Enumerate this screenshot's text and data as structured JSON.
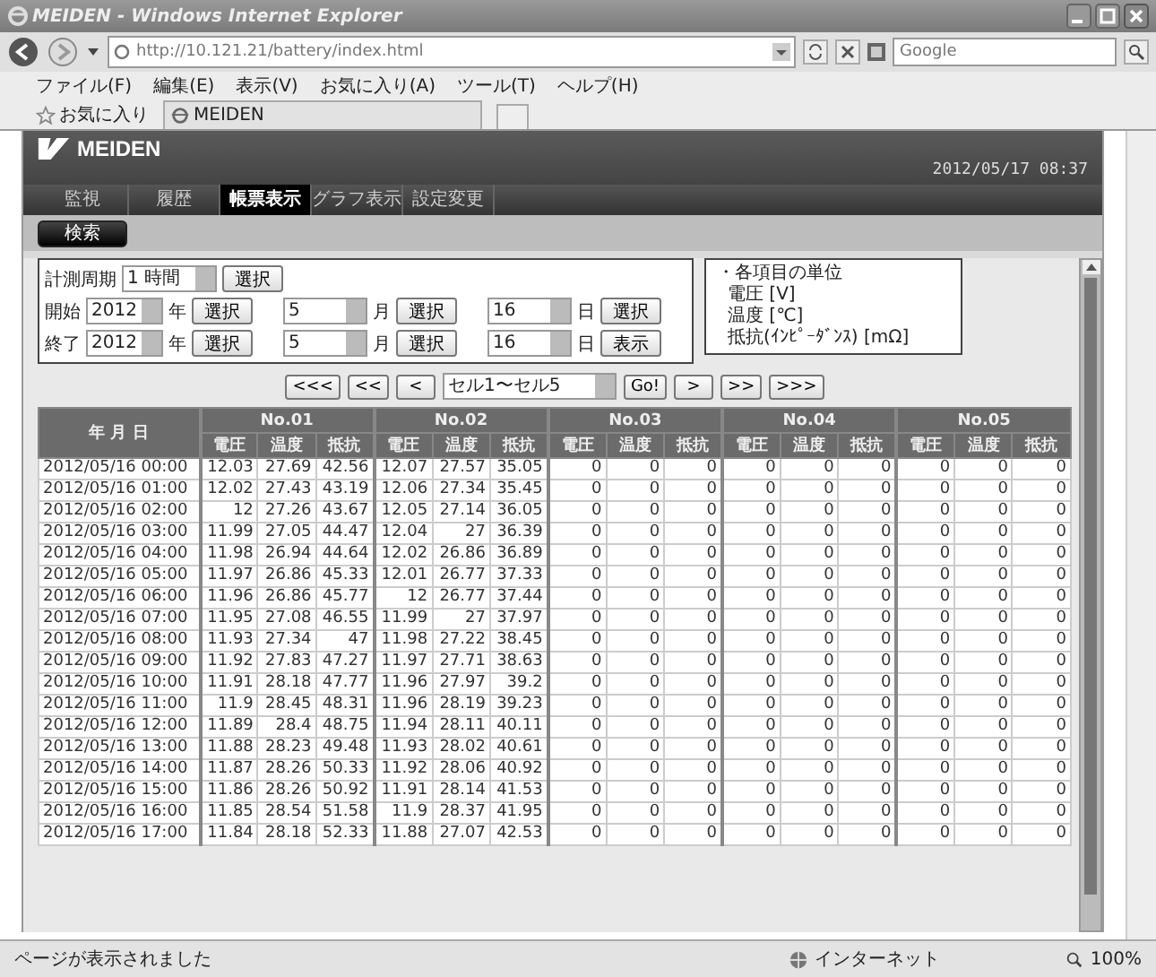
{
  "window": {
    "title": "MEIDEN - Windows Internet Explorer"
  },
  "address_bar": {
    "url": "http://10.121.21/battery/index.html",
    "search_placeholder": "Google"
  },
  "menu": [
    "ファイル(F)",
    "編集(E)",
    "表示(V)",
    "お気に入り(A)",
    "ツール(T)",
    "ヘルプ(H)"
  ],
  "favorites_bar": {
    "label": "お気に入り",
    "tab": "MEIDEN"
  },
  "page": {
    "logo": "MEIDEN",
    "datetime": "2012/05/17 08:37",
    "nav": [
      {
        "label": "監視",
        "selected": false
      },
      {
        "label": "履歴",
        "selected": false
      },
      {
        "label": "帳票表示",
        "selected": true
      },
      {
        "label": "グラフ表示",
        "selected": false
      },
      {
        "label": "設定変更",
        "selected": false
      }
    ],
    "search_button": "検索",
    "form": {
      "period": {
        "label": "計測周期",
        "value": "1 時間",
        "button": "選択"
      },
      "ranges": [
        {
          "label": "開始",
          "fields": [
            {
              "value": "2012",
              "unit": "年",
              "button": "選択"
            },
            {
              "value": "5",
              "unit": "月",
              "button": "選択"
            },
            {
              "value": "16",
              "unit": "日",
              "button": "選択"
            }
          ]
        },
        {
          "label": "終了",
          "fields": [
            {
              "value": "2012",
              "unit": "年",
              "button": "選択"
            },
            {
              "value": "5",
              "unit": "月",
              "button": "選択"
            },
            {
              "value": "16",
              "unit": "日",
              "button": "表示"
            }
          ]
        }
      ]
    },
    "units": {
      "heading": "・各項目の単位",
      "items": [
        "電圧 [V]",
        "温度 [℃]",
        "抵抗(ｲﾝﾋﾟｰﾀﾞﾝｽ) [mΩ]"
      ]
    },
    "pager": {
      "before": [
        "<<<",
        "<<",
        "<"
      ],
      "select": "セル1〜セル5",
      "go": "Go!",
      "after": [
        ">",
        ">>",
        ">>>"
      ]
    },
    "table": {
      "date_header": "年 月 日",
      "groups": [
        {
          "label": "No.01",
          "subcolumns": [
            "電圧",
            "温度",
            "抵抗"
          ]
        },
        {
          "label": "No.02",
          "subcolumns": [
            "電圧",
            "温度",
            "抵抗"
          ]
        },
        {
          "label": "No.03",
          "subcolumns": [
            "電圧",
            "温度",
            "抵抗"
          ]
        },
        {
          "label": "No.04",
          "subcolumns": [
            "電圧",
            "温度",
            "抵抗"
          ]
        },
        {
          "label": "No.05",
          "subcolumns": [
            "電圧",
            "温度",
            "抵抗"
          ]
        }
      ],
      "rows": [
        {
          "date": "2012/05/16 00:00",
          "values": [
            "12.03",
            "27.69",
            "42.56",
            "12.07",
            "27.57",
            "35.05",
            "0",
            "0",
            "0",
            "0",
            "0",
            "0",
            "0",
            "0",
            "0"
          ]
        },
        {
          "date": "2012/05/16 01:00",
          "values": [
            "12.02",
            "27.43",
            "43.19",
            "12.06",
            "27.34",
            "35.45",
            "0",
            "0",
            "0",
            "0",
            "0",
            "0",
            "0",
            "0",
            "0"
          ]
        },
        {
          "date": "2012/05/16 02:00",
          "values": [
            "12",
            "27.26",
            "43.67",
            "12.05",
            "27.14",
            "36.05",
            "0",
            "0",
            "0",
            "0",
            "0",
            "0",
            "0",
            "0",
            "0"
          ]
        },
        {
          "date": "2012/05/16 03:00",
          "values": [
            "11.99",
            "27.05",
            "44.47",
            "12.04",
            "27",
            "36.39",
            "0",
            "0",
            "0",
            "0",
            "0",
            "0",
            "0",
            "0",
            "0"
          ]
        },
        {
          "date": "2012/05/16 04:00",
          "values": [
            "11.98",
            "26.94",
            "44.64",
            "12.02",
            "26.86",
            "36.89",
            "0",
            "0",
            "0",
            "0",
            "0",
            "0",
            "0",
            "0",
            "0"
          ]
        },
        {
          "date": "2012/05/16 05:00",
          "values": [
            "11.97",
            "26.86",
            "45.33",
            "12.01",
            "26.77",
            "37.33",
            "0",
            "0",
            "0",
            "0",
            "0",
            "0",
            "0",
            "0",
            "0"
          ]
        },
        {
          "date": "2012/05/16 06:00",
          "values": [
            "11.96",
            "26.86",
            "45.77",
            "12",
            "26.77",
            "37.44",
            "0",
            "0",
            "0",
            "0",
            "0",
            "0",
            "0",
            "0",
            "0"
          ]
        },
        {
          "date": "2012/05/16 07:00",
          "values": [
            "11.95",
            "27.08",
            "46.55",
            "11.99",
            "27",
            "37.97",
            "0",
            "0",
            "0",
            "0",
            "0",
            "0",
            "0",
            "0",
            "0"
          ]
        },
        {
          "date": "2012/05/16 08:00",
          "values": [
            "11.93",
            "27.34",
            "47",
            "11.98",
            "27.22",
            "38.45",
            "0",
            "0",
            "0",
            "0",
            "0",
            "0",
            "0",
            "0",
            "0"
          ]
        },
        {
          "date": "2012/05/16 09:00",
          "values": [
            "11.92",
            "27.83",
            "47.27",
            "11.97",
            "27.71",
            "38.63",
            "0",
            "0",
            "0",
            "0",
            "0",
            "0",
            "0",
            "0",
            "0"
          ]
        },
        {
          "date": "2012/05/16 10:00",
          "values": [
            "11.91",
            "28.18",
            "47.77",
            "11.96",
            "27.97",
            "39.2",
            "0",
            "0",
            "0",
            "0",
            "0",
            "0",
            "0",
            "0",
            "0"
          ]
        },
        {
          "date": "2012/05/16 11:00",
          "values": [
            "11.9",
            "28.45",
            "48.31",
            "11.96",
            "28.19",
            "39.23",
            "0",
            "0",
            "0",
            "0",
            "0",
            "0",
            "0",
            "0",
            "0"
          ]
        },
        {
          "date": "2012/05/16 12:00",
          "values": [
            "11.89",
            "28.4",
            "48.75",
            "11.94",
            "28.11",
            "40.11",
            "0",
            "0",
            "0",
            "0",
            "0",
            "0",
            "0",
            "0",
            "0"
          ]
        },
        {
          "date": "2012/05/16 13:00",
          "values": [
            "11.88",
            "28.23",
            "49.48",
            "11.93",
            "28.02",
            "40.61",
            "0",
            "0",
            "0",
            "0",
            "0",
            "0",
            "0",
            "0",
            "0"
          ]
        },
        {
          "date": "2012/05/16 14:00",
          "values": [
            "11.87",
            "28.26",
            "50.33",
            "11.92",
            "28.06",
            "40.92",
            "0",
            "0",
            "0",
            "0",
            "0",
            "0",
            "0",
            "0",
            "0"
          ]
        },
        {
          "date": "2012/05/16 15:00",
          "values": [
            "11.86",
            "28.26",
            "50.92",
            "11.91",
            "28.14",
            "41.53",
            "0",
            "0",
            "0",
            "0",
            "0",
            "0",
            "0",
            "0",
            "0"
          ]
        },
        {
          "date": "2012/05/16 16:00",
          "values": [
            "11.85",
            "28.54",
            "51.58",
            "11.9",
            "28.37",
            "41.95",
            "0",
            "0",
            "0",
            "0",
            "0",
            "0",
            "0",
            "0",
            "0"
          ]
        },
        {
          "date": "2012/05/16 17:00",
          "values": [
            "11.84",
            "28.18",
            "52.33",
            "11.88",
            "27.07",
            "42.53",
            "0",
            "0",
            "0",
            "0",
            "0",
            "0",
            "0",
            "0",
            "0"
          ]
        }
      ]
    }
  },
  "status_bar": {
    "text": "ページが表示されました",
    "zone": "インターネット",
    "zoom": "100%"
  }
}
